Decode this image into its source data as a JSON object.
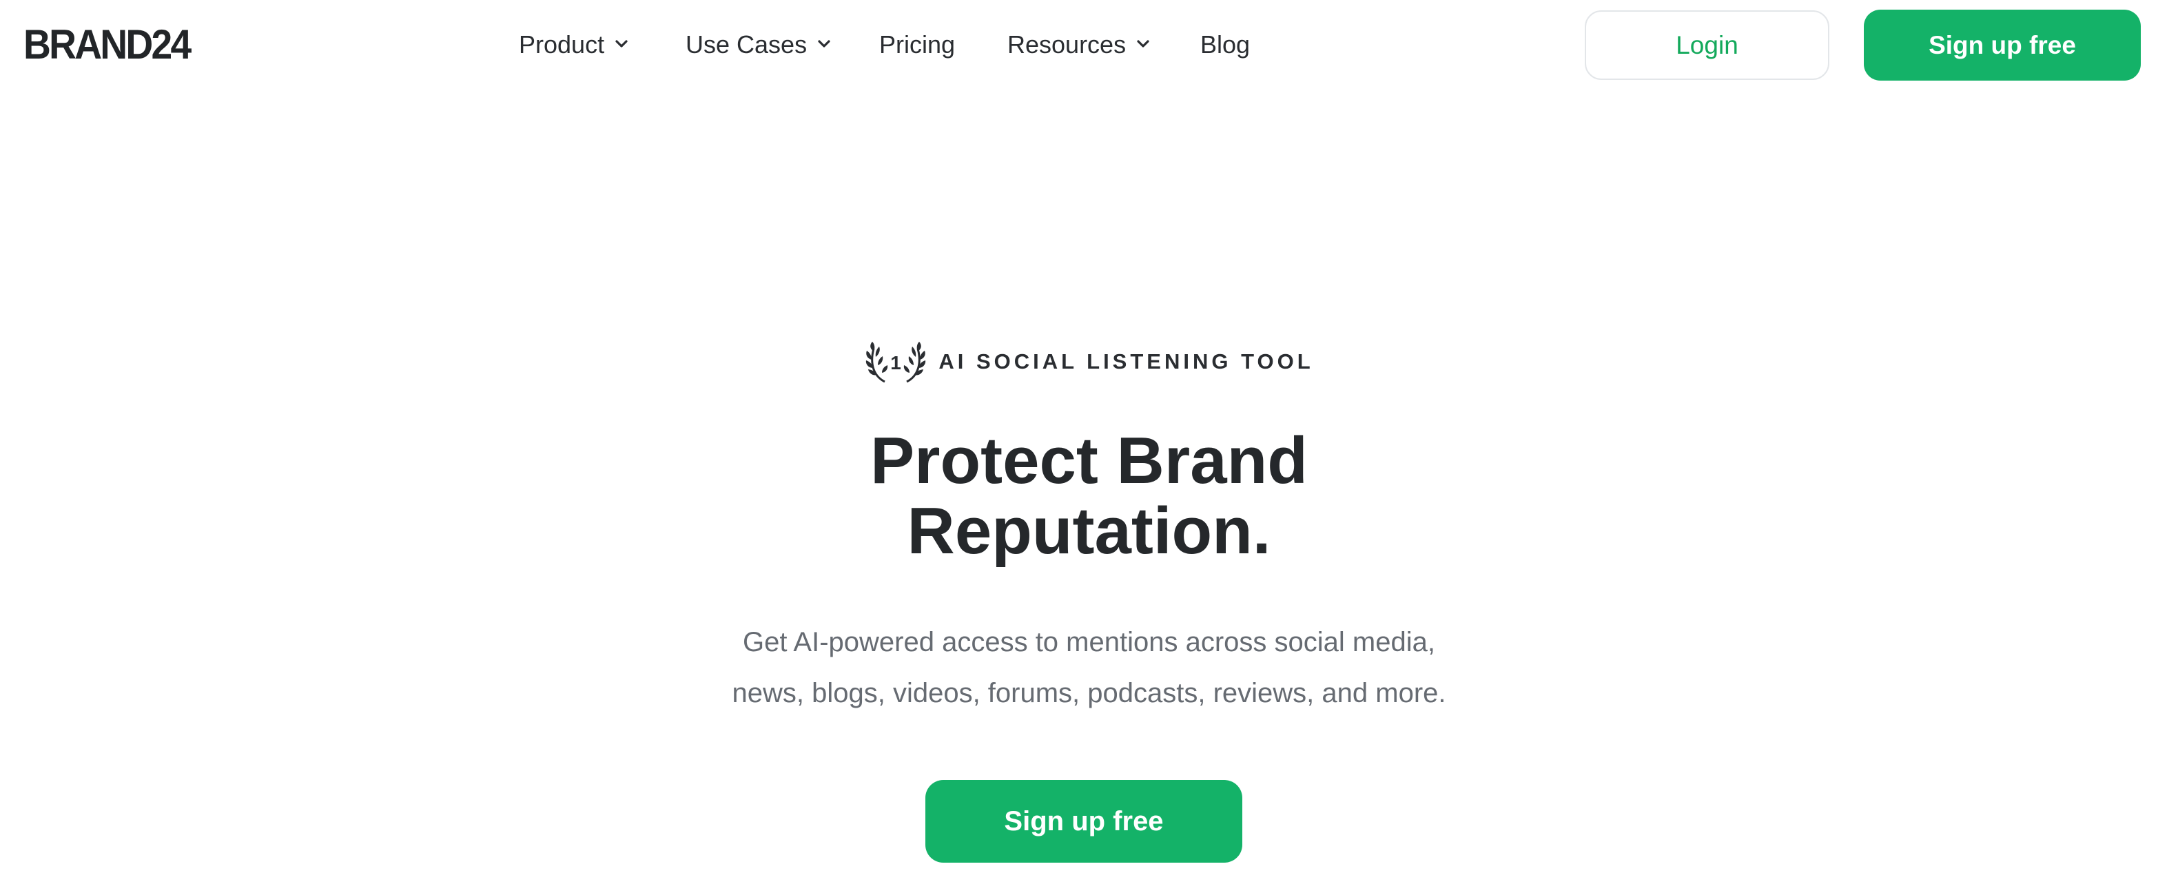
{
  "brand": {
    "logo_text": "BRAND24"
  },
  "nav": {
    "items": [
      {
        "label": "Product",
        "has_dropdown": true
      },
      {
        "label": "Use Cases",
        "has_dropdown": true
      },
      {
        "label": "Pricing",
        "has_dropdown": false
      },
      {
        "label": "Resources",
        "has_dropdown": true
      },
      {
        "label": "Blog",
        "has_dropdown": false
      }
    ],
    "icons": {
      "dropdown": "chevron-down-icon"
    }
  },
  "header_actions": {
    "login_label": "Login",
    "signup_label": "Sign up free"
  },
  "hero": {
    "badge_number": "1",
    "badge_icon": "laurel-wreath-icon",
    "badge_text": "AI SOCIAL LISTENING TOOL",
    "title_line1": "Protect Brand",
    "title_line2": "Reputation.",
    "subtitle_line1": "Get AI-powered access to mentions across social media,",
    "subtitle_line2": "news, blogs, videos, forums, podcasts, reviews, and more.",
    "cta_label": "Sign up free"
  },
  "colors": {
    "accent_green": "#14b268",
    "text_dark": "#25282b",
    "text_muted": "#666b72",
    "border_light": "#e3e6e9"
  }
}
